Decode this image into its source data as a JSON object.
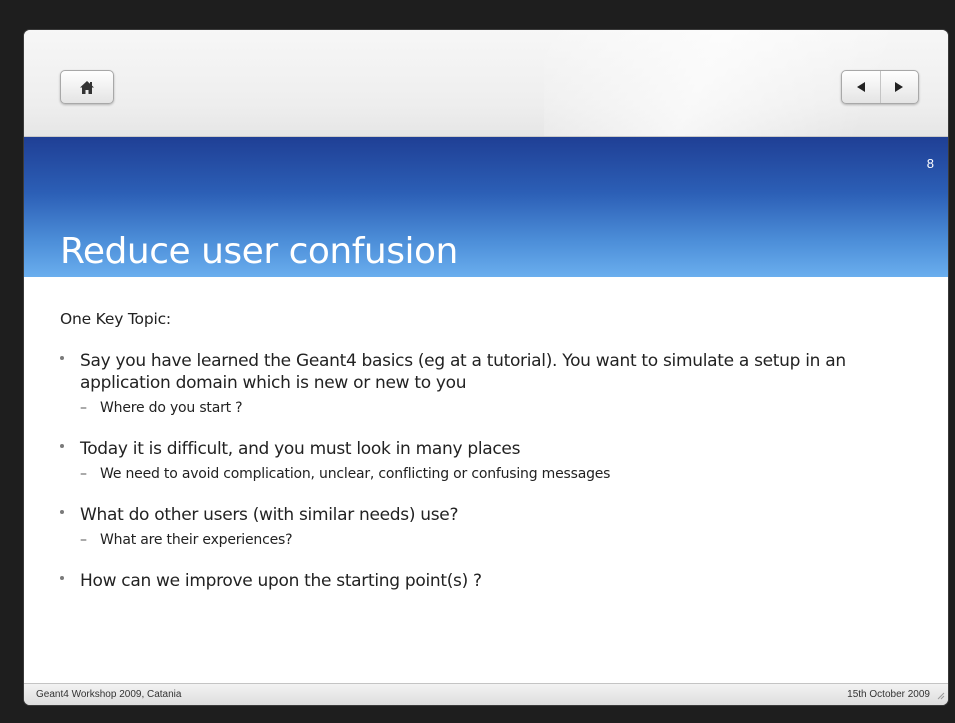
{
  "slide": {
    "number": "8",
    "title": "Reduce user confusion",
    "intro": "One Key Topic:",
    "bullets": [
      {
        "text": "Say you have learned the Geant4 basics (eg at a tutorial). You want to simulate a setup in an application domain which is new or new to you",
        "sub": "Where do you start ?"
      },
      {
        "text": "Today it is difficult, and you must look in many places",
        "sub": "We need to avoid complication, unclear, conflicting or confusing messages"
      },
      {
        "text": "What do other users (with similar needs) use?",
        "sub": "What are their experiences?"
      },
      {
        "text": "How can we improve upon the starting point(s) ?"
      }
    ]
  },
  "footer": {
    "left": "Geant4 Workshop 2009, Catania",
    "right": "15th October 2009"
  },
  "icons": {
    "home": "home-icon",
    "previous": "triangle-left-icon",
    "next": "triangle-right-icon"
  },
  "colors": {
    "title_band_top": "#1f3f95",
    "title_band_bottom": "#6aaeee",
    "title_text": "#ffffff",
    "body_text": "#222222"
  }
}
